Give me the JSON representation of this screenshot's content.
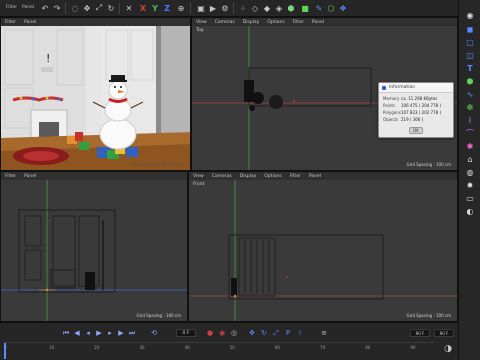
{
  "toolbar": {
    "menu": [
      "Filter",
      "Panel"
    ],
    "axis_labels": [
      "X",
      "Y",
      "Z"
    ]
  },
  "viewports": {
    "perspective": {
      "menu": [
        "Filter",
        "Panel"
      ],
      "grid_spacing": "Grid Spacing : 100000 cm"
    },
    "top": {
      "menu": [
        "View",
        "Cameras",
        "Display",
        "Options",
        "Filter",
        "Panel"
      ],
      "name": "Top",
      "grid_spacing": "Grid Spacing : 100 cm"
    },
    "right": {
      "menu": [
        "Filter",
        "Panel"
      ],
      "grid_spacing": "Grid Spacing : 100 cm"
    },
    "front": {
      "menu": [
        "View",
        "Cameras",
        "Display",
        "Options",
        "Filter",
        "Panel"
      ],
      "name": "Front",
      "grid_spacing": "Grid Spacing : 100 cm"
    }
  },
  "info_dialog": {
    "title": "Information",
    "rows": [
      {
        "key": "Memory",
        "value": "ca. 11 298 KBytes"
      },
      {
        "key": "Points",
        "value": "106 475 ( 204 778 )"
      },
      {
        "key": "Polygons",
        "value": "107 823 ( 202 778 )"
      },
      {
        "key": "Objects",
        "value": "219 ( 366 )"
      }
    ],
    "ok_label": "OK"
  },
  "timeline": {
    "frame_field": "0 F",
    "ruler_labels": [
      "0",
      "10",
      "20",
      "30",
      "40",
      "50",
      "60",
      "70",
      "80",
      "90"
    ],
    "end_fields": [
      "90 F",
      "90 F"
    ]
  },
  "colors": {
    "accent_blue": "#5b8cff",
    "axis_x": "#d04040",
    "axis_y": "#40c040",
    "axis_z": "#4080ff"
  }
}
